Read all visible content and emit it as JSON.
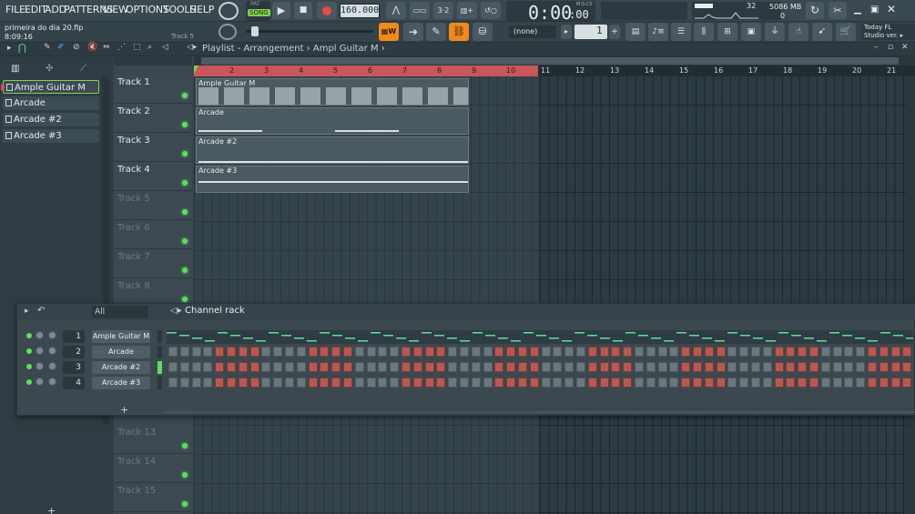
{
  "menu": [
    "FILE",
    "EDIT",
    "ADD",
    "PATTERNS",
    "VIEW",
    "OPTIONS",
    "TOOLS",
    "HELP"
  ],
  "transport": {
    "pat_label": "PAT",
    "song_label": "SONG",
    "tempo": "160.000",
    "time": "0:00",
    "time_frac": ":00",
    "time_unit": "M:S:CS"
  },
  "monitor": {
    "cpu_value": "32",
    "memory": "5086 MB",
    "voices": "0"
  },
  "file": {
    "name": "primeira do dia 20.flp",
    "time": "8:09:16",
    "hint": "Track 5"
  },
  "pattern_selector": "(none)",
  "snap_value": "1",
  "news": {
    "line1": "Today  FL",
    "line2": "Studio ver. ▸"
  },
  "playlist_title": "Playlist - Arrangement › Ampl Guitar M ›",
  "ruler_bars": [
    "2",
    "3",
    "4",
    "5",
    "6",
    "7",
    "8",
    "9",
    "10",
    "11",
    "12",
    "13",
    "14",
    "15",
    "16",
    "17",
    "18",
    "19",
    "20",
    "21"
  ],
  "patterns": [
    "Ample Guitar M",
    "Arcade",
    "Arcade #2",
    "Arcade #3"
  ],
  "tracks": [
    "Track 1",
    "Track 2",
    "Track 3",
    "Track 4",
    "Track 5",
    "Track 6",
    "Track 7",
    "Track 8"
  ],
  "tracks_bottom": [
    "Track 13",
    "Track 14",
    "Track 15"
  ],
  "clips": [
    "Ample Guitar M",
    "Arcade",
    "Arcade #2",
    "Arcade #3"
  ],
  "rack": {
    "title": "Channel rack",
    "filter": "All",
    "channels": [
      {
        "num": "1",
        "name": "Ample Guitar M"
      },
      {
        "num": "2",
        "name": "Arcade"
      },
      {
        "num": "3",
        "name": "Arcade #2"
      },
      {
        "num": "4",
        "name": "Arcade #3"
      }
    ],
    "add": "+"
  },
  "colors": {
    "loop_bar": "#c8565a",
    "step_on": "#b55a52",
    "led": "#5ce05c",
    "orange": "#f08a1c"
  }
}
